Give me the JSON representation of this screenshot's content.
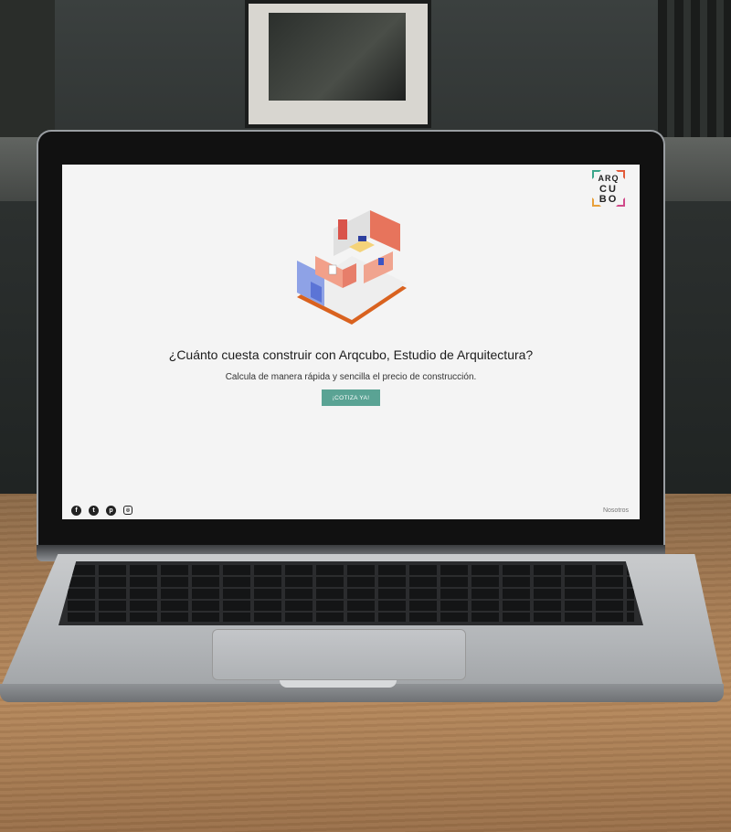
{
  "logo": {
    "line1": "ARQ",
    "line2": "CU",
    "line3": "BO"
  },
  "hero": {
    "headline": "¿Cuánto cuesta construir con Arqcubo, Estudio de Arquitectura?",
    "subheadline": "Calcula de manera rápida y sencilla el precio de construcción.",
    "cta_label": "¡COTIZA YA!"
  },
  "social": {
    "facebook": "f",
    "twitter": "t",
    "pinterest": "p",
    "instagram": "◎",
    "icons": [
      "facebook-icon",
      "twitter-icon",
      "pinterest-icon",
      "instagram-icon"
    ]
  },
  "footer": {
    "about_link": "Nosotros"
  },
  "colors": {
    "accent": "#5aa394",
    "background": "#f4f4f4",
    "text": "#1c1c1c"
  }
}
